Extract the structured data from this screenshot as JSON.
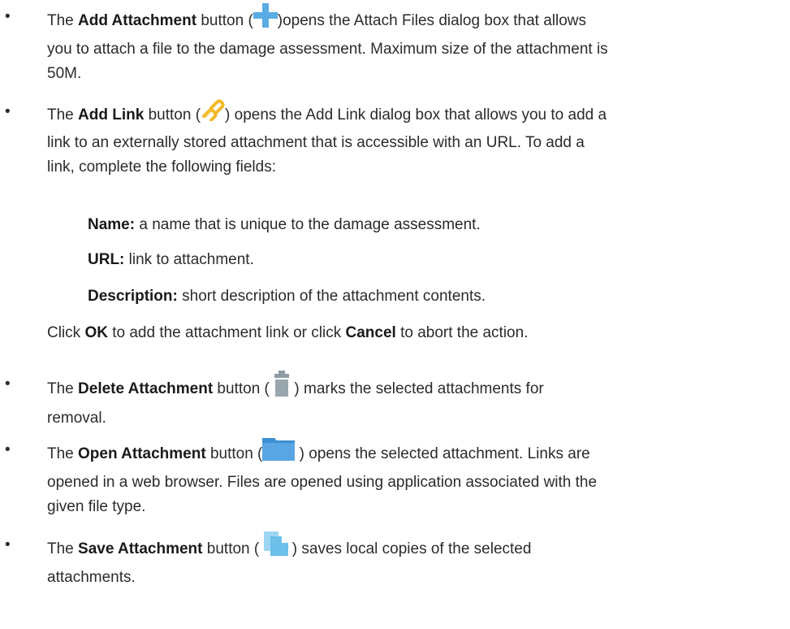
{
  "bullet_char": "•",
  "items": [
    {
      "prefix": "The ",
      "label": "Add Attachment",
      "icon": "plus-icon",
      "pre_icon": " button (",
      "post_icon": ")opens the Attach Files dialog box that allows",
      "line2": "you to attach a file to the damage assessment. Maximum size of the attachment is",
      "line3": "50M."
    },
    {
      "prefix": "The ",
      "label": "Add Link",
      "icon": "link-icon",
      "pre_icon": " button (",
      "post_icon": ") opens the Add Link dialog box that allows you to add a",
      "line2": "link to an externally stored attachment that is accessible with an URL. To add a",
      "line3": "link, complete the following fields:"
    },
    {
      "prefix": "The ",
      "label": "Delete Attachment",
      "icon": "trash-icon",
      "pre_icon": " button ( ",
      "post_icon": " ) marks the selected attachments for",
      "line2": "removal."
    },
    {
      "prefix": "The ",
      "label": "Open Attachment",
      "icon": "folder-icon",
      "pre_icon": " button (",
      "post_icon": " ) opens the selected attachment. Links are",
      "line2": "opened in a web browser. Files are opened using application associated with the",
      "line3": "given file type."
    },
    {
      "prefix": "The ",
      "label": "Save Attachment",
      "icon": "copy-icon",
      "pre_icon": " button ( ",
      "post_icon": " ) saves local copies of the selected",
      "line2": "attachments."
    }
  ],
  "fields": [
    {
      "label": "Name:",
      "text": " a name that is unique to the damage assessment."
    },
    {
      "label": "URL:",
      "text": " link to attachment."
    },
    {
      "label": "Description:",
      "text": " short description of the attachment contents."
    }
  ],
  "click": {
    "pre": "Click ",
    "ok": "OK",
    "mid": " to add the attachment link or click ",
    "cancel": "Cancel",
    "post": " to abort the action."
  },
  "colors": {
    "plus_icon": "#5aace4",
    "link_icon": "#f2b824",
    "trash_icon": "#8f9ba3",
    "folder_icon": "#4a9ad8",
    "copy_icon": "#6cc0ea"
  }
}
